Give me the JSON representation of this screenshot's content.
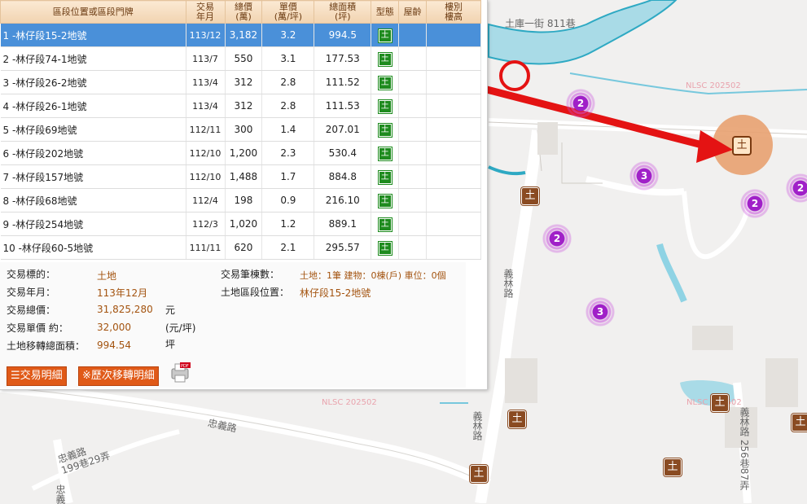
{
  "table": {
    "headers": [
      "區段位置或區段門牌",
      "交易\n年月",
      "總價\n(萬)",
      "單價\n(萬/坪)",
      "總面積\n(坪)",
      "型態",
      "屋齡",
      "樓別\n樓高"
    ],
    "rows": [
      {
        "name": "1 -林仔段15-2地號",
        "date": "113/12",
        "total": "3,182",
        "unit": "3.2",
        "area": "994.5",
        "type": "土"
      },
      {
        "name": "2 -林仔段74-1地號",
        "date": "113/7",
        "total": "550",
        "unit": "3.1",
        "area": "177.53",
        "type": "土"
      },
      {
        "name": "3 -林仔段26-2地號",
        "date": "113/4",
        "total": "312",
        "unit": "2.8",
        "area": "111.52",
        "type": "土"
      },
      {
        "name": "4 -林仔段26-1地號",
        "date": "113/4",
        "total": "312",
        "unit": "2.8",
        "area": "111.53",
        "type": "土"
      },
      {
        "name": "5 -林仔段69地號",
        "date": "112/11",
        "total": "300",
        "unit": "1.4",
        "area": "207.01",
        "type": "土"
      },
      {
        "name": "6 -林仔段202地號",
        "date": "112/10",
        "total": "1,200",
        "unit": "2.3",
        "area": "530.4",
        "type": "土"
      },
      {
        "name": "7 -林仔段157地號",
        "date": "112/10",
        "total": "1,488",
        "unit": "1.7",
        "area": "884.8",
        "type": "土"
      },
      {
        "name": "8 -林仔段68地號",
        "date": "112/4",
        "total": "198",
        "unit": "0.9",
        "area": "216.10",
        "type": "土"
      },
      {
        "name": "9 -林仔段254地號",
        "date": "112/3",
        "total": "1,020",
        "unit": "1.2",
        "area": "889.1",
        "type": "土"
      },
      {
        "name": "10 -林仔段60-5地號",
        "date": "111/11",
        "total": "620",
        "unit": "2.1",
        "area": "295.57",
        "type": "土"
      }
    ]
  },
  "detail": {
    "subject_label": "交易標的：",
    "subject": "土地",
    "date_label": "交易年月：",
    "date": "113年12月",
    "total_label": "交易總價：",
    "total": "31,825,280",
    "total_unit": "元",
    "unit_label": "交易單價 約：",
    "unit": "32,000",
    "unit_unit": "(元/坪)",
    "area_label": "土地移轉總面積：",
    "area": "994.54",
    "area_unit": "坪",
    "count_label": "交易筆棟數：",
    "count": "土地：1筆 建物：0棟(戶) 車位：0個",
    "location_label": "土地區段位置：",
    "location": "林仔段15-2地號"
  },
  "buttons": {
    "details": "交易明細",
    "history": "※歷次移轉明細"
  },
  "map": {
    "roads": [
      "土庫一街 811巷",
      "義林路",
      "義林路",
      "忠義路",
      "忠義路\n199巷29弄",
      "義林路 256巷87弄",
      "忠義"
    ],
    "watermarks": [
      "NLSC 202502",
      "NLSC 202502",
      "NLSC 202502"
    ],
    "land_marker_label": "土",
    "clusters": [
      "2",
      "3",
      "2",
      "2",
      "3"
    ]
  },
  "colors": {
    "selected_row": "#4a90d9",
    "cluster": "#a020c8",
    "land_marker": "#8a4b22",
    "arrow": "#e41313",
    "header": "#f1d3b0"
  }
}
